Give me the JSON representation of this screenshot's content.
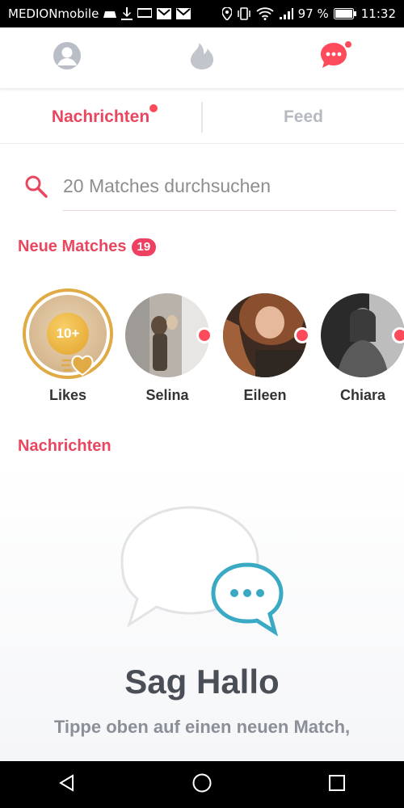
{
  "status_bar": {
    "carrier": "MEDIONmobile",
    "battery": "97 %",
    "time": "11:32"
  },
  "top_nav": {
    "items": [
      {
        "name": "profile",
        "icon": "profile-icon"
      },
      {
        "name": "discover",
        "icon": "flame-icon"
      },
      {
        "name": "messages",
        "icon": "chat-icon",
        "active": true
      }
    ],
    "accent": "#fd4b5b"
  },
  "tabs": [
    {
      "label": "Nachrichten",
      "active": true
    },
    {
      "label": "Feed",
      "active": false
    }
  ],
  "search": {
    "placeholder": "20 Matches durchsuchen"
  },
  "new_matches": {
    "title": "Neue Matches",
    "count": "19",
    "likes": {
      "count": "10+",
      "label": "Likes"
    },
    "matches": [
      {
        "name": "Selina"
      },
      {
        "name": "Eileen"
      },
      {
        "name": "Chiara"
      }
    ]
  },
  "messages_section": {
    "title": "Nachrichten"
  },
  "empty_state": {
    "title": "Sag Hallo",
    "hint": "Tippe oben auf einen neuen Match,"
  },
  "colors": {
    "accent": "#e8475f",
    "gold": "#e0aa45",
    "teal": "#3aa9c4"
  }
}
